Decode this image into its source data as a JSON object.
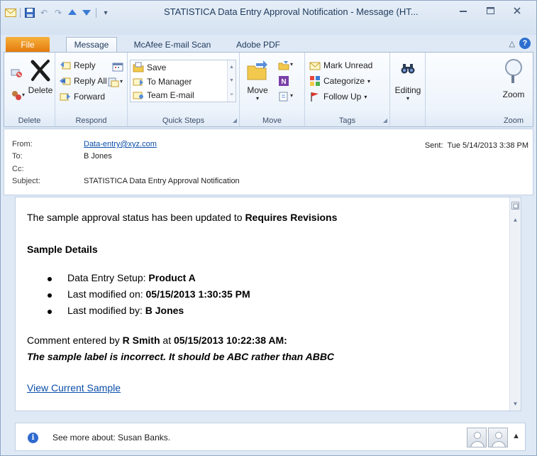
{
  "window": {
    "title": "STATISTICA Data Entry Approval Notification  -  Message (HT..."
  },
  "tabs": [
    {
      "label": "File"
    },
    {
      "label": "Message"
    },
    {
      "label": "McAfee E-mail Scan"
    },
    {
      "label": "Adobe PDF"
    }
  ],
  "ribbon": {
    "delete": {
      "group": "Delete",
      "delete_label": "Delete"
    },
    "respond": {
      "group": "Respond",
      "reply": "Reply",
      "reply_all": "Reply All",
      "forward": "Forward"
    },
    "quick_steps": {
      "group": "Quick Steps",
      "items": [
        "Save",
        "To Manager",
        "Team E-mail"
      ]
    },
    "move": {
      "group": "Move",
      "move_label": "Move"
    },
    "tags": {
      "group": "Tags",
      "mark_unread": "Mark Unread",
      "categorize": "Categorize",
      "follow_up": "Follow Up"
    },
    "editing": {
      "label": "Editing"
    },
    "zoom": {
      "group": "Zoom",
      "label": "Zoom"
    }
  },
  "header": {
    "from_label": "From:",
    "from_value": "Data-entry@xyz.com",
    "to_label": "To:",
    "to_value": "B Jones",
    "cc_label": "Cc:",
    "subject_label": "Subject:",
    "subject_value": "STATISTICA Data Entry Approval Notification",
    "sent_label": "Sent:",
    "sent_value": "Tue 5/14/2013 3:38 PM"
  },
  "body": {
    "status_prefix": "The sample approval status has been updated to ",
    "status_value": "Requires Revisions",
    "details_heading": "Sample Details",
    "setup_label": "Data Entry Setup: ",
    "setup_value": "Product A",
    "modified_on_label": "Last modified on: ",
    "modified_on_value": "05/15/2013 1:30:35 PM",
    "modified_by_label": "Last modified by: ",
    "modified_by_value": "B Jones",
    "comment_prefix": "Comment entered by ",
    "comment_author": "R Smith",
    "comment_at": " at ",
    "comment_time": "05/15/2013 10:22:38 AM:",
    "comment_text": "The sample label is incorrect. It should be ABC rather than ABBC",
    "view_link": "View Current Sample"
  },
  "people_pane": {
    "see_more": "See more about: Susan Banks."
  }
}
